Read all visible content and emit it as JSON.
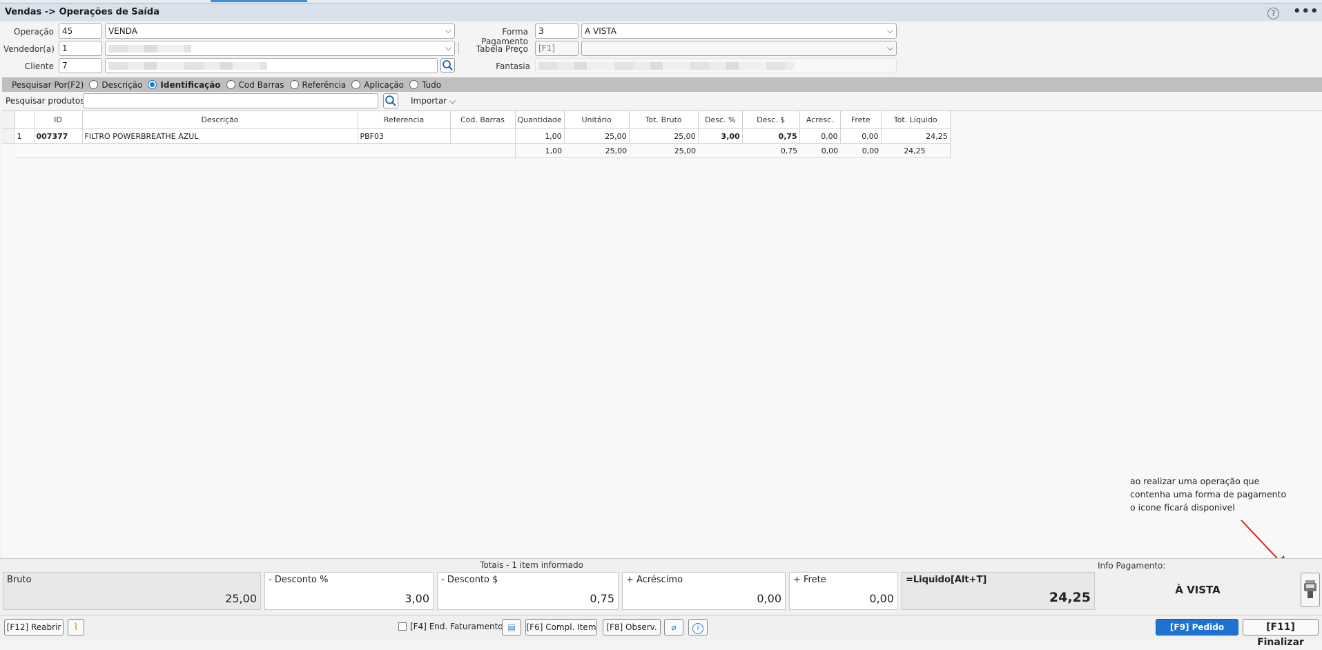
{
  "window": {
    "title": "Vendas -> Operações de Saída",
    "help": "?",
    "more": "•••"
  },
  "form": {
    "operacao_label": "Operação",
    "operacao_code": "45",
    "operacao_name": "VENDA",
    "vendedor_label": "Vendedor(a)",
    "vendedor_code": "1",
    "cliente_label": "Cliente",
    "cliente_code": "7",
    "forma_label": "Forma Pagamento",
    "forma_code": "3",
    "forma_name": "A VISTA",
    "tabela_label": "Tabela Preço",
    "tabela_code": "[F1]",
    "fantasia_label": "Fantasia"
  },
  "search": {
    "label": "Pesquisar Por(F2)",
    "options": [
      "Descrição",
      "Identificação",
      "Cod Barras",
      "Referência",
      "Aplicação",
      "Tudo"
    ],
    "selected": "Identificação",
    "products_label": "Pesquisar produtos:",
    "importar": "Importar"
  },
  "grid": {
    "columns": [
      "ID",
      "Descrição",
      "Referencia",
      "Cod. Barras",
      "Quantidade",
      "Unitário",
      "Tot. Bruto",
      "Desc. %",
      "Desc. $",
      "Acresc.",
      "Frete",
      "Tot. Líquido"
    ],
    "rows": [
      {
        "n": "1",
        "id": "007377",
        "desc": "FILTRO POWERBREATHE AZUL",
        "ref": "PBF03",
        "barras": "",
        "qtd": "1,00",
        "unit": "25,00",
        "bruto": "25,00",
        "descp": "3,00",
        "descv": "0,75",
        "acresc": "0,00",
        "frete": "0,00",
        "liq": "24,25"
      }
    ],
    "totals": {
      "qtd": "1,00",
      "unit": "25,00",
      "bruto": "25,00",
      "descv": "0,75",
      "acresc": "0,00",
      "frete": "0,00",
      "liq": "24,25"
    }
  },
  "summary": {
    "caption": "Totais - 1 item informado",
    "info_label": "Info Pagamento:",
    "bruto_label": "Bruto",
    "bruto": "25,00",
    "descp_label": "- Desconto %",
    "descp": "3,00",
    "descv_label": "- Desconto $",
    "descv": "0,75",
    "acresc_label": "+ Acréscimo",
    "acresc": "0,00",
    "frete_label": "+ Frete",
    "frete": "0,00",
    "liq_label": "=Liquido[Alt+T]",
    "liq": "24,25",
    "payment": "À VISTA"
  },
  "annotation": {
    "line1": "ao realizar uma operação que",
    "line2": "contenha uma forma de pagamento",
    "line3": "o icone ficará disponivel"
  },
  "toolbar": {
    "reabrir": "[F12] Reabrir",
    "end_fat": "[F4] End. Faturamento",
    "compl": "[F6] Compl. Item",
    "observ": "[F8] Observ.",
    "pedido": "[F9] Pedido",
    "finalizar": "[F11] Finalizar"
  },
  "colors": {
    "accent": "#1e73d2",
    "annotation_arrow": "#e02020"
  }
}
